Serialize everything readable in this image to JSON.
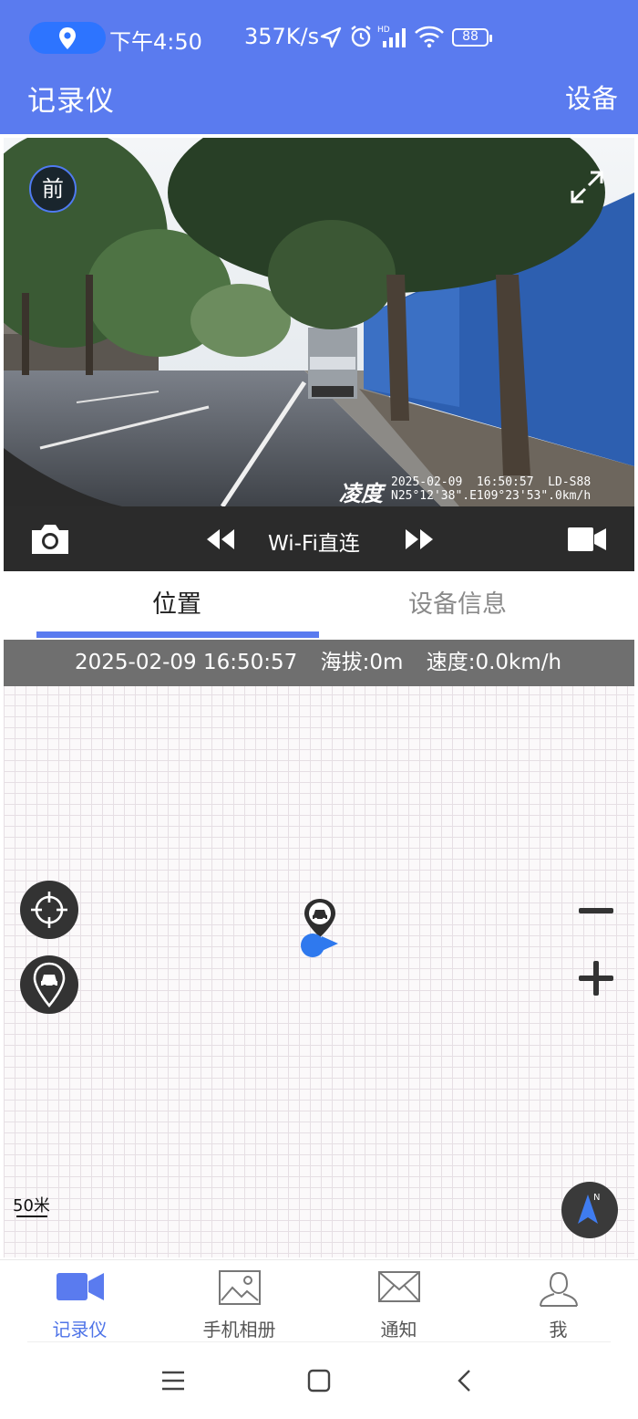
{
  "status_bar": {
    "time": "下午4:50",
    "network_speed": "357K/s",
    "battery": "88",
    "icons": [
      "location-icon",
      "navigation-arrow-icon",
      "alarm-icon",
      "hd-signal-icon",
      "wifi-icon",
      "battery-icon"
    ]
  },
  "app_bar": {
    "title": "记录仪",
    "action": "设备"
  },
  "camera": {
    "channel_badge": "前",
    "osd_brand": "凌度",
    "osd_line1": "2025-02-09  16:50:57  LD-S88",
    "osd_line2": "N25°12'38\".E109°23'53\".0km/h",
    "expand_icon": "expand-icon"
  },
  "controls": {
    "connection_label": "Wi-Fi直连",
    "icons": [
      "camera-icon",
      "rewind-icon",
      "fast-forward-icon",
      "video-camera-icon"
    ]
  },
  "tabs": [
    {
      "label": "位置",
      "active": true
    },
    {
      "label": "设备信息",
      "active": false
    }
  ],
  "map": {
    "datetime": "2025-02-09 16:50:57",
    "altitude": "海拔:0m",
    "speed": "速度:0.0km/h",
    "scale_label": "50米",
    "compass_letter": "N"
  },
  "bottom_nav": [
    {
      "label": "记录仪",
      "icon": "video-camera-icon",
      "active": true
    },
    {
      "label": "手机相册",
      "icon": "image-icon",
      "active": false
    },
    {
      "label": "通知",
      "icon": "mail-icon",
      "active": false
    },
    {
      "label": "我",
      "icon": "user-icon",
      "active": false
    }
  ],
  "colors": {
    "primary": "#5a7bef",
    "active_tab_indicator": "#5a7bef",
    "nav_active": "#4f74e8",
    "map_marker_blue": "#2f79ee",
    "control_bar": "#2b2b2b"
  }
}
